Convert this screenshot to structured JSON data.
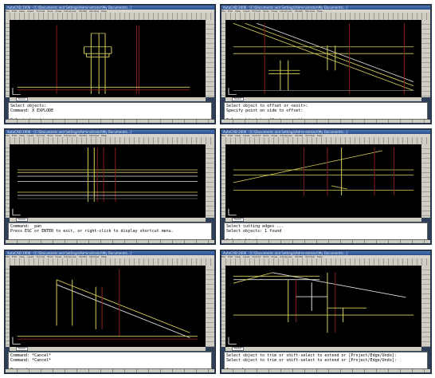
{
  "app": {
    "title": "AutoCAD 2006 - [C:\\Documents and Settings\\Administrator\\My Documents\\...]",
    "menus": [
      "File",
      "Edit",
      "View",
      "Insert",
      "Format",
      "Tools",
      "Draw",
      "Dimension",
      "Modify",
      "Window",
      "Help"
    ],
    "model_tab": "Model"
  },
  "panels": [
    {
      "id": "p1",
      "lines": [
        "Select objects:",
        "Command: X EXPLODE",
        "",
        "Select objects:"
      ]
    },
    {
      "id": "p2",
      "lines": [
        "Select object to offset or <exit>:",
        "Specify point on side to offset:",
        "",
        "Select object to offset or <exit>:"
      ]
    },
    {
      "id": "p3",
      "lines": [
        "Command: _pan",
        "Press ESC or ENTER to exit, or right-click to display shortcut menu.",
        "",
        ""
      ]
    },
    {
      "id": "p4",
      "lines": [
        "Select cutting edges ...",
        "Select objects: 1 found",
        "",
        "Select objects:"
      ]
    },
    {
      "id": "p5",
      "lines": [
        "Command: *Cancel*",
        "Command: *Cancel*",
        "",
        "Command:"
      ]
    },
    {
      "id": "p6",
      "lines": [
        "Select object to trim or shift-select to extend or [Project/Edge/Undo]:",
        "Select object to trim or shift-select to extend or [Project/Edge/Undo]:",
        "",
        "Command:"
      ]
    }
  ],
  "colors": {
    "yellow": "#d8cf5a",
    "red": "#8a1f1f",
    "white": "#e0e0e0",
    "grey": "#6a6a6a"
  }
}
